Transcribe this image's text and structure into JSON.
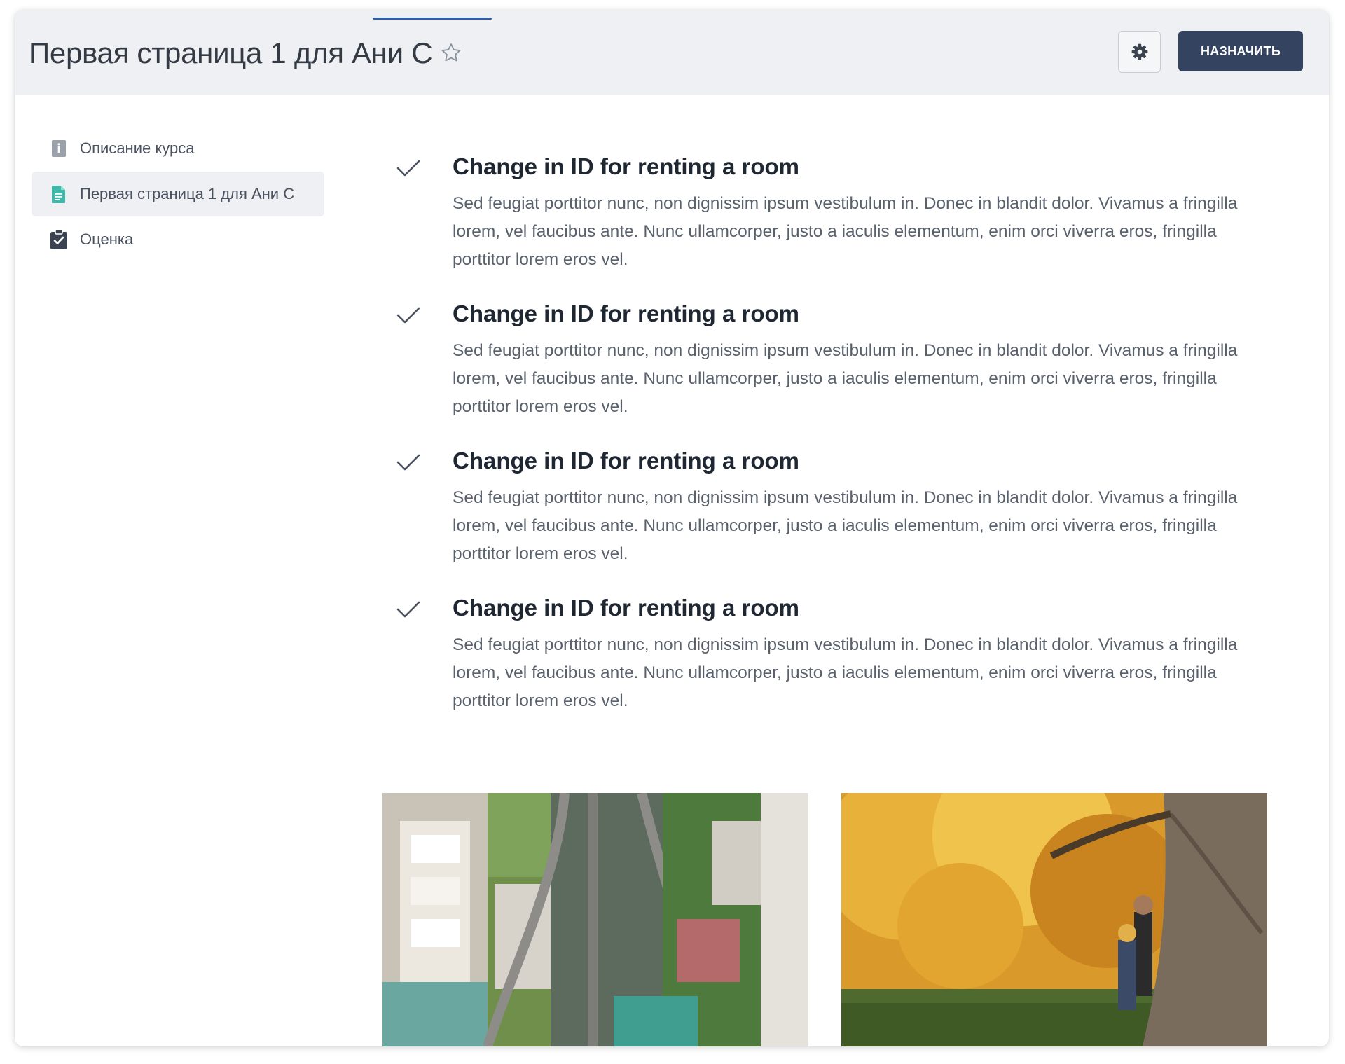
{
  "header": {
    "title": "Первая страница 1 для Ани С",
    "assign_label": "НАЗНАЧИТЬ",
    "icons": {
      "favorite": "star-outline-icon",
      "settings": "gear-icon"
    }
  },
  "sidebar": {
    "items": [
      {
        "label": "Описание курса",
        "icon": "info-book-icon",
        "active": false
      },
      {
        "label": "Первая страница 1 для Ани С",
        "icon": "document-icon",
        "active": true
      },
      {
        "label": "Оценка",
        "icon": "clipboard-check-icon",
        "active": false
      }
    ]
  },
  "checklist": [
    {
      "title": "Change in ID for renting a room",
      "text": "Sed feugiat porttitor nunc, non dignissim ipsum vestibulum in. Donec in blandit dolor. Vivamus a fringilla lorem, vel faucibus ante. Nunc ullamcorper, justo a iaculis elementum, enim orci viverra eros, fringilla porttitor lorem eros vel."
    },
    {
      "title": "Change in ID for renting a room",
      "text": "Sed feugiat porttitor nunc, non dignissim ipsum vestibulum in. Donec in blandit dolor. Vivamus a fringilla lorem, vel faucibus ante. Nunc ullamcorper, justo a iaculis elementum, enim orci viverra eros, fringilla porttitor lorem eros vel."
    },
    {
      "title": "Change in ID for renting a room",
      "text": "Sed feugiat porttitor nunc, non dignissim ipsum vestibulum in. Donec in blandit dolor. Vivamus a fringilla lorem, vel faucibus ante. Nunc ullamcorper, justo a iaculis elementum, enim orci viverra eros, fringilla porttitor lorem eros vel."
    },
    {
      "title": "Change in ID for renting a room",
      "text": "Sed feugiat porttitor nunc, non dignissim ipsum vestibulum in. Donec in blandit dolor. Vivamus a fringilla lorem, vel faucibus ante. Nunc ullamcorper, justo a iaculis elementum, enim orci viverra eros, fringilla porttitor lorem eros vel."
    }
  ],
  "colors": {
    "header_bg": "#eef0f3",
    "assign_button": "#34435f",
    "active_tab": "#2f5fa8",
    "document_icon": "#3fb8a9",
    "title_text": "#1f2733"
  }
}
